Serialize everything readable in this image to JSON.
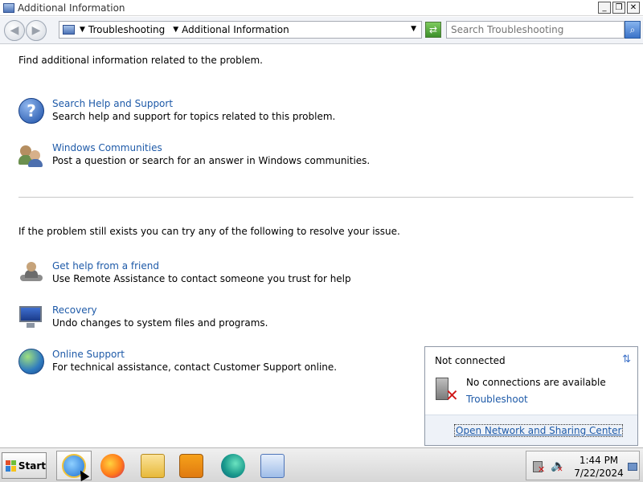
{
  "window": {
    "title": "Additional Information",
    "buttons": {
      "minimize": "_",
      "restore": "❐",
      "close": "✕"
    }
  },
  "navbar": {
    "back_icon": "◀",
    "forward_icon": "▶",
    "breadcrumb": [
      "Troubleshooting",
      "Additional Information"
    ],
    "search_placeholder": "Search Troubleshooting",
    "refresh_icon": "⇄",
    "search_icon": "⌕"
  },
  "content": {
    "intro": "Find additional information related to the problem.",
    "section1_items": [
      {
        "icon": "help-icon",
        "link": "Search Help and Support",
        "desc": "Search help and support for topics related to this problem."
      },
      {
        "icon": "community-icon",
        "link": "Windows Communities",
        "desc": "Post a question or search for an answer in Windows communities."
      }
    ],
    "intro2": "If the problem still exists you can try any of the following to resolve your issue.",
    "section2_items": [
      {
        "icon": "friend-icon",
        "link": "Get help from a friend",
        "desc": "Use Remote Assistance to contact someone you trust for help"
      },
      {
        "icon": "recovery-icon",
        "link": "Recovery",
        "desc": "Undo changes to system files and programs."
      },
      {
        "icon": "online-support-icon",
        "link": "Online Support",
        "desc": "For technical assistance, contact Customer Support online."
      }
    ]
  },
  "network_popup": {
    "status": "Not connected",
    "message": "No connections are available",
    "troubleshoot": "Troubleshoot",
    "open_center": "Open Network and Sharing Center"
  },
  "taskbar": {
    "start_label": "Start",
    "apps": [
      "internet-explorer-icon",
      "firefox-icon",
      "file-explorer-icon",
      "media-player-icon",
      "edge-icon",
      "control-panel-icon"
    ],
    "time": "1:44 PM",
    "date": "7/22/2024"
  }
}
